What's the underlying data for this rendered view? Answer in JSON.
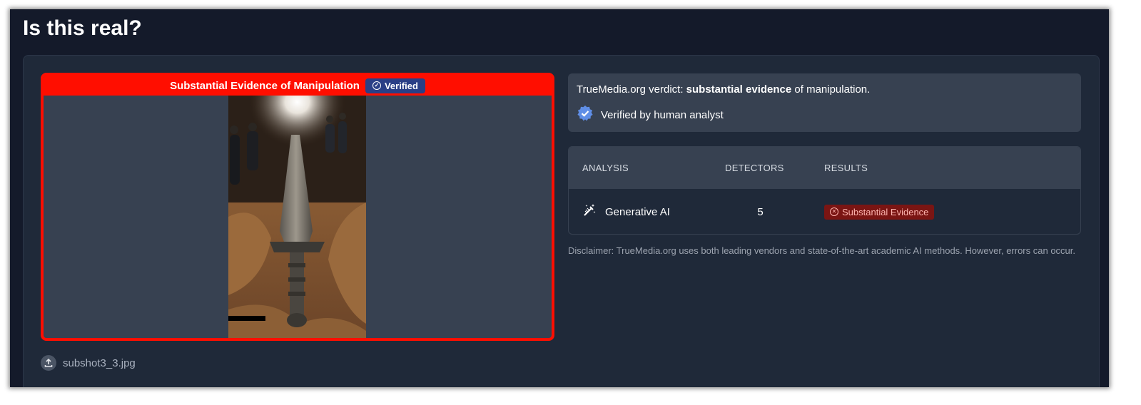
{
  "page": {
    "title": "Is this real?"
  },
  "media": {
    "banner_text": "Substantial Evidence of Manipulation",
    "verified_label": "Verified",
    "image_description": "",
    "file_name": "subshot3_3.jpg",
    "frame_color": "#ff0e00"
  },
  "verdict": {
    "prefix": "TrueMedia.org verdict: ",
    "emphasis": "substantial evidence",
    "suffix": " of manipulation.",
    "analyst_text": "Verified by human analyst"
  },
  "analysis_table": {
    "headers": [
      "ANALYSIS",
      "DETECTORS",
      "RESULTS"
    ],
    "rows": [
      {
        "analysis": "Generative AI",
        "icon": "magic-wand-icon",
        "detectors": "5",
        "result": "Substantial Evidence"
      }
    ]
  },
  "disclaimer": "Disclaimer: TrueMedia.org uses both leading vendors and state-of-the-art academic AI methods. However, errors can occur.",
  "colors": {
    "background": "#141a2a",
    "card": "#1f2939",
    "panel": "#374151",
    "danger": "#ff0e00",
    "verified_chip": "#2a3f86",
    "result_badge": "#7a1513"
  }
}
